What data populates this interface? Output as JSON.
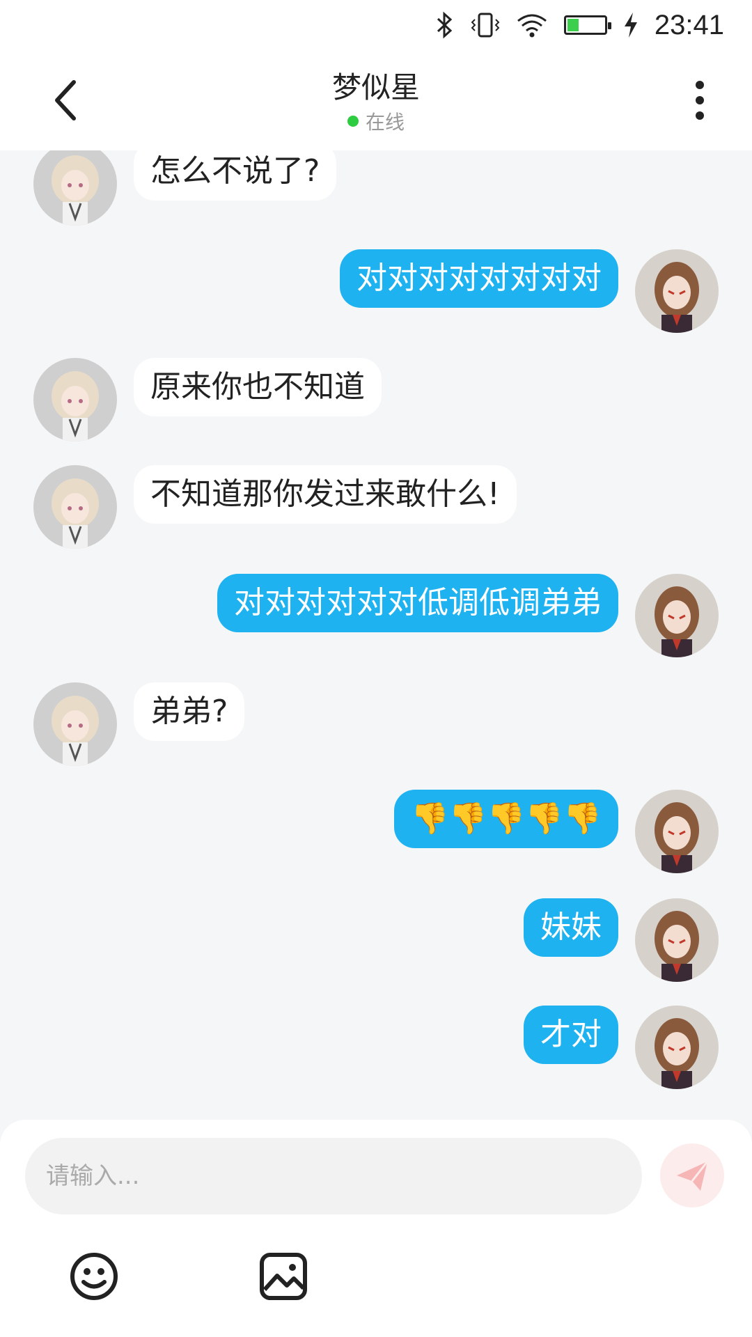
{
  "status_bar": {
    "time": "23:41",
    "icons": [
      "bluetooth-icon",
      "vibrate-icon",
      "wifi-icon",
      "battery-icon",
      "charging-icon"
    ]
  },
  "header": {
    "title": "梦似星",
    "status": "在线",
    "back_icon": "chevron-left-icon",
    "more_icon": "more-vertical-icon"
  },
  "messages": [
    {
      "side": "in",
      "text": "怎么不说了?"
    },
    {
      "side": "out",
      "text": "对对对对对对对对"
    },
    {
      "side": "in",
      "text": "原来你也不知道"
    },
    {
      "side": "in",
      "text": "不知道那你发过来敢什么!"
    },
    {
      "side": "out",
      "text": "对对对对对对低调低调弟弟"
    },
    {
      "side": "in",
      "text": "弟弟?"
    },
    {
      "side": "out",
      "text": "👎👎👎👎👎"
    },
    {
      "side": "out",
      "text": "妹妹"
    },
    {
      "side": "out",
      "text": "才对"
    }
  ],
  "input": {
    "placeholder": "请输入...",
    "send_icon": "send-icon",
    "emoji_icon": "smile-icon",
    "image_icon": "image-icon"
  },
  "colors": {
    "outgoing_bubble": "#1fb2f0",
    "incoming_bubble": "#ffffff",
    "chat_background": "#f4f6f8",
    "online_dot": "#2ecc40",
    "battery_level": "#3ccf4e"
  },
  "battery_level": 0.3
}
